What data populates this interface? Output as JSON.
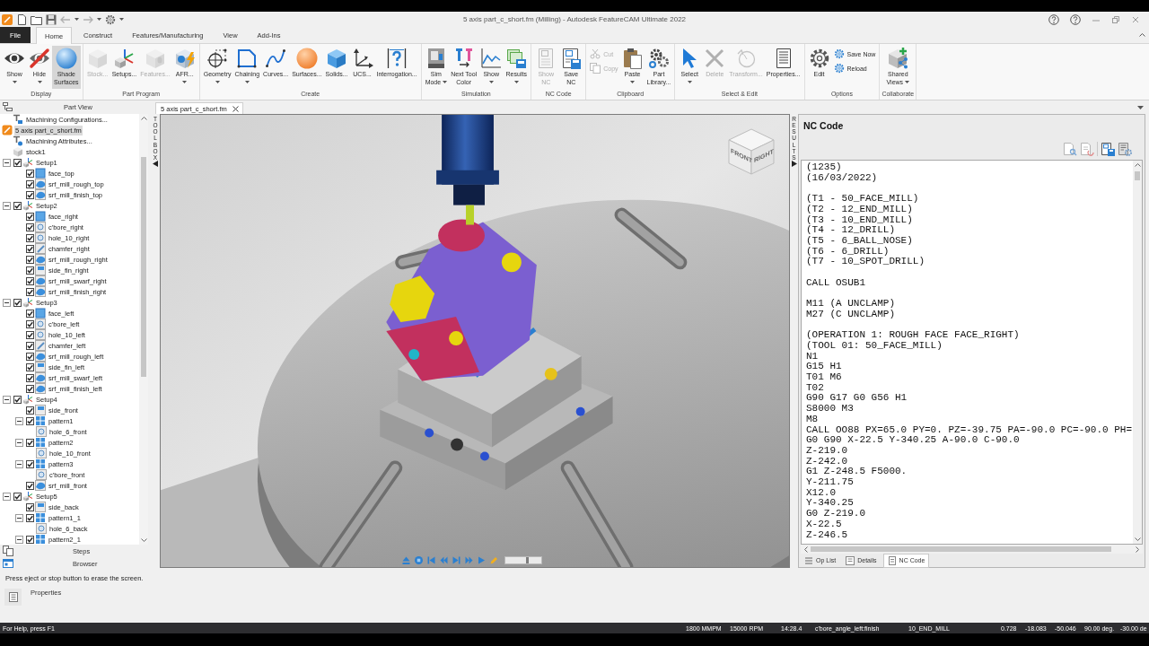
{
  "title_bar": {
    "title": "5 axis part_c_short.fm (Milling) - Autodesk FeatureCAM Ultimate 2022"
  },
  "ribbon": {
    "tabs": [
      {
        "label": "File",
        "kind": "file",
        "selected": false
      },
      {
        "label": "Home",
        "kind": "tab",
        "selected": true
      },
      {
        "label": "Construct",
        "kind": "tab",
        "selected": false
      },
      {
        "label": "Features/Manufacturing",
        "kind": "tab",
        "selected": false
      },
      {
        "label": "View",
        "kind": "tab",
        "selected": false
      },
      {
        "label": "Add-Ins",
        "kind": "tab",
        "selected": false
      }
    ],
    "groups": [
      {
        "label": "Display",
        "items": [
          {
            "kind": "large",
            "label": "Show",
            "menu": true,
            "disabled": false,
            "pressed": false
          },
          {
            "kind": "large",
            "label": "Hide",
            "menu": true,
            "disabled": false,
            "pressed": false
          },
          {
            "kind": "large",
            "label": "Shade\nSurfaces",
            "menu": false,
            "disabled": false,
            "pressed": true
          }
        ]
      },
      {
        "label": "Part Program",
        "items": [
          {
            "kind": "large",
            "label": "Stock...",
            "menu": false,
            "disabled": true
          },
          {
            "kind": "large",
            "label": "Setups...",
            "menu": false,
            "disabled": false
          },
          {
            "kind": "large",
            "label": "Features...",
            "menu": false,
            "disabled": true
          },
          {
            "kind": "large",
            "label": "AFR...",
            "menu": true,
            "disabled": false
          }
        ]
      },
      {
        "label": "Create",
        "items": [
          {
            "kind": "large",
            "label": "Geometry",
            "menu": true,
            "disabled": false
          },
          {
            "kind": "large",
            "label": "Chaining",
            "menu": true,
            "disabled": false
          },
          {
            "kind": "large",
            "label": "Curves...",
            "menu": false,
            "disabled": false
          },
          {
            "kind": "large",
            "label": "Surfaces...",
            "menu": false,
            "disabled": false
          },
          {
            "kind": "large",
            "label": "Solids...",
            "menu": false,
            "disabled": false
          },
          {
            "kind": "large",
            "label": "UCS...",
            "menu": false,
            "disabled": false
          },
          {
            "kind": "large",
            "label": "Interrogation...",
            "menu": false,
            "disabled": false
          }
        ]
      },
      {
        "label": "Simulation",
        "items": [
          {
            "kind": "large",
            "label": "Sim\nMode",
            "menu": true,
            "disabled": false
          },
          {
            "kind": "large",
            "label": "Next Tool\nColor",
            "menu": false,
            "disabled": false
          },
          {
            "kind": "large",
            "label": "Show",
            "menu": true,
            "disabled": false
          },
          {
            "kind": "large",
            "label": "Results",
            "menu": true,
            "disabled": false
          }
        ]
      },
      {
        "label": "NC Code",
        "items": [
          {
            "kind": "large",
            "label": "Show\nNC",
            "menu": false,
            "disabled": true
          },
          {
            "kind": "large",
            "label": "Save\nNC",
            "menu": false,
            "disabled": false
          }
        ]
      },
      {
        "label": "Clipboard",
        "items": [
          {
            "kind": "stack",
            "buttons": [
              {
                "label": "Cut",
                "disabled": true
              },
              {
                "label": "Copy",
                "disabled": true
              }
            ]
          },
          {
            "kind": "large",
            "label": "Paste",
            "menu": true,
            "disabled": false
          },
          {
            "kind": "large",
            "label": "Part\nLibrary...",
            "menu": false,
            "disabled": false
          }
        ]
      },
      {
        "label": "Select & Edit",
        "items": [
          {
            "kind": "large",
            "label": "Select",
            "menu": true,
            "disabled": false
          },
          {
            "kind": "large",
            "label": "Delete",
            "menu": false,
            "disabled": true
          },
          {
            "kind": "large",
            "label": "Transform...",
            "menu": false,
            "disabled": true
          },
          {
            "kind": "large",
            "label": "Properties...",
            "menu": false,
            "disabled": false
          }
        ]
      },
      {
        "label": "Options",
        "items": [
          {
            "kind": "large",
            "label": "Edit",
            "menu": false,
            "disabled": false
          },
          {
            "kind": "stack",
            "buttons": [
              {
                "label": "Save Now",
                "disabled": false
              },
              {
                "label": "Reload",
                "disabled": false
              }
            ]
          }
        ]
      },
      {
        "label": "Collaborate",
        "items": [
          {
            "kind": "large",
            "label": "Shared\nViews",
            "menu": true,
            "disabled": false
          }
        ]
      }
    ]
  },
  "part_view": {
    "title": "Part View",
    "tree": {
      "roots": [
        {
          "label": "Machining Configurations...",
          "kind": "config",
          "selected": false
        },
        {
          "label": "5 axis part_c_short.fm",
          "kind": "part",
          "selected": true
        },
        {
          "label": "Machining Attributes...",
          "kind": "attributes",
          "selected": false
        },
        {
          "label": "stock1",
          "kind": "stock",
          "selected": false
        }
      ],
      "setups": [
        {
          "label": "Setup1",
          "kind": "setup",
          "expanded": true,
          "checked": true,
          "selected": false,
          "children": [
            {
              "label": "face_top",
              "kind": "face",
              "checked": true,
              "selected": false
            },
            {
              "label": "srf_mill_rough_top",
              "kind": "surface",
              "checked": true,
              "selected": false
            },
            {
              "label": "srf_mill_finish_top",
              "kind": "surface",
              "checked": true,
              "selected": false
            }
          ]
        },
        {
          "label": "Setup2",
          "kind": "setup",
          "expanded": true,
          "checked": true,
          "selected": false,
          "children": [
            {
              "label": "face_right",
              "kind": "face",
              "checked": true,
              "selected": false
            },
            {
              "label": "c'bore_right",
              "kind": "hole",
              "checked": true,
              "selected": false
            },
            {
              "label": "hole_10_right",
              "kind": "hole",
              "checked": true,
              "selected": false
            },
            {
              "label": "chamfer_right",
              "kind": "chamfer",
              "checked": true,
              "selected": false
            },
            {
              "label": "srf_mill_rough_right",
              "kind": "surface",
              "checked": true,
              "selected": false
            },
            {
              "label": "side_fin_right",
              "kind": "side",
              "checked": true,
              "selected": false
            },
            {
              "label": "srf_mill_swarf_right",
              "kind": "surface",
              "checked": true,
              "selected": false
            },
            {
              "label": "srf_mill_finish_right",
              "kind": "surface",
              "checked": true,
              "selected": false
            }
          ]
        },
        {
          "label": "Setup3",
          "kind": "setup",
          "expanded": true,
          "checked": true,
          "selected": false,
          "children": [
            {
              "label": "face_left",
              "kind": "face",
              "checked": true,
              "selected": false
            },
            {
              "label": "c'bore_left",
              "kind": "hole",
              "checked": true,
              "selected": false
            },
            {
              "label": "hole_10_left",
              "kind": "hole",
              "checked": true,
              "selected": false
            },
            {
              "label": "chamfer_left",
              "kind": "chamfer",
              "checked": true,
              "selected": false
            },
            {
              "label": "srf_mill_rough_left",
              "kind": "surface",
              "checked": true,
              "selected": false
            },
            {
              "label": "side_fin_left",
              "kind": "side",
              "checked": true,
              "selected": false
            },
            {
              "label": "srf_mill_swarf_left",
              "kind": "surface",
              "checked": true,
              "selected": false
            },
            {
              "label": "srf_mill_finish_left",
              "kind": "surface",
              "checked": true,
              "selected": false
            }
          ]
        },
        {
          "label": "Setup4",
          "kind": "setup",
          "expanded": true,
          "checked": true,
          "selected": false,
          "children": [
            {
              "label": "side_front",
              "kind": "side",
              "checked": true,
              "selected": false
            },
            {
              "label": "pattern1",
              "kind": "pattern",
              "checked": true,
              "expanded": true,
              "selected": false,
              "children": [
                {
                  "label": "hole_6_front",
                  "kind": "hole",
                  "selected": false
                }
              ]
            },
            {
              "label": "pattern2",
              "kind": "pattern",
              "checked": true,
              "expanded": true,
              "selected": false,
              "children": [
                {
                  "label": "hole_10_front",
                  "kind": "hole",
                  "selected": false
                }
              ]
            },
            {
              "label": "pattern3",
              "kind": "pattern",
              "checked": true,
              "expanded": true,
              "selected": false,
              "children": [
                {
                  "label": "c'bore_front",
                  "kind": "hole",
                  "selected": false
                }
              ]
            },
            {
              "label": "srf_mill_front",
              "kind": "surface",
              "checked": true,
              "selected": false
            }
          ]
        },
        {
          "label": "Setup5",
          "kind": "setup",
          "expanded": true,
          "checked": true,
          "selected": false,
          "children": [
            {
              "label": "side_back",
              "kind": "side",
              "checked": true,
              "selected": false
            },
            {
              "label": "pattern1_1",
              "kind": "pattern",
              "checked": true,
              "expanded": true,
              "selected": false,
              "children": [
                {
                  "label": "hole_6_back",
                  "kind": "hole",
                  "selected": false
                }
              ]
            },
            {
              "label": "pattern2_1",
              "kind": "pattern",
              "checked": true,
              "expanded": true,
              "selected": false
            }
          ]
        }
      ]
    },
    "panel_tabs": [
      {
        "label": "Steps"
      },
      {
        "label": "Browser"
      }
    ],
    "message": "Press eject or stop button to erase the screen.",
    "properties": {
      "label": "Properties"
    }
  },
  "document_tabs": [
    {
      "label": "5 axis part_c_short.fm",
      "selected": true
    }
  ],
  "viewport": {
    "toolbox_label": "TOOLBOX",
    "view_cube": {
      "faces": [
        "FRONT",
        "RIGHT"
      ]
    },
    "speed_slider": {
      "level": 0.6
    },
    "results_label": "RESULTS"
  },
  "nc_code": {
    "title": "NC Code",
    "blocks": [
      [
        "(1235)",
        "(16/03/2022)"
      ],
      [
        "(T1 - 50_FACE_MILL)",
        "(T2 - 12_END_MILL)",
        "(T3 - 10_END_MILL)",
        "(T4 - 12_DRILL)",
        "(T5 - 6_BALL_NOSE)",
        "(T6 - 6_DRILL)",
        "(T7 - 10_SPOT_DRILL)"
      ],
      [
        "CALL OSUB1"
      ],
      [
        "M11 (A UNCLAMP)",
        "M27 (C UNCLAMP)"
      ],
      [
        "(OPERATION 1: ROUGH FACE FACE_RIGHT)",
        "(TOOL 01: 50_FACE_MILL)",
        "N1",
        "G15 H1",
        "T01 M6",
        "T02",
        "G90 G17 G0 G56 H1",
        "S8000 M3",
        "M8",
        "CALL OO88 PX=65.0 PY=0. PZ=-39.75 PA=-90.0 PC=-90.0 PH=",
        "G0 G90 X-22.5 Y-340.25 A-90.0 C-90.0",
        "Z-219.0",
        "Z-242.0",
        "G1 Z-248.5 F5000.",
        "Y-211.75",
        "X12.0",
        "Y-340.25",
        "G0 Z-219.0",
        "X-22.5",
        "Z-246.5"
      ]
    ],
    "tabs": [
      {
        "label": "Op List",
        "selected": false
      },
      {
        "label": "Details",
        "selected": false
      },
      {
        "label": "NC Code",
        "selected": true
      }
    ]
  },
  "status_bar": {
    "help": "For Help, press F1",
    "fields": [
      "1800 MMPM",
      "15000 RPM",
      "14:28.4",
      "c'bore_angle_left:finish",
      "10_END_MILL",
      "0.728",
      "-18.083",
      "-50.046",
      "90.00 deg.",
      "-30.00 de"
    ]
  }
}
